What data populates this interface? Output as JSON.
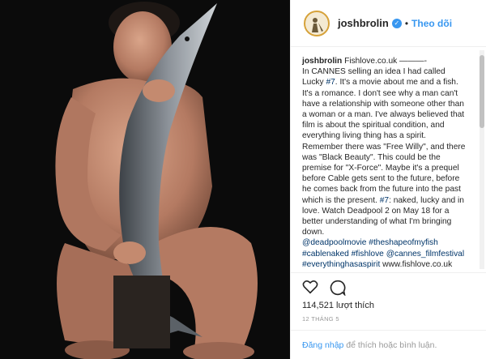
{
  "header": {
    "username": "joshbrolin",
    "separator": "•",
    "follow_label": "Theo dõi"
  },
  "caption": {
    "username": "joshbrolin",
    "line1": "Fishlove.co.uk ———-",
    "part_a": "In CANNES selling an idea I had called Lucky ",
    "hashtag7a": "#7",
    "part_b": ". It's a movie about me and a fish. It's a romance. I don't see why a man can't have a relationship with someone other than a woman or a man. I've always believed that film is about the spiritual condition, and everything living thing has a spirit. Remember there was \"Free Willy\", and there was \"Black Beauty\". This could be the premise for \"X-Force\". Maybe it's a prequel before Cable gets sent to the future, before he comes back from the future into the past which is the present.",
    "hashtag7b": "#7",
    "part_c": ": naked, lucky and in love. Watch Deadpool 2 on May 18 for a better understanding of what I'm bringing down.",
    "tag1": "@deadpoolmovie",
    "tag2": "#theshapeofmyfish",
    "tag3": "#cablenaked",
    "tag4": "#fishlove",
    "tag5": "@cannes_filmfestival",
    "tag6": "#everythinghasaspirit",
    "url": "www.fishlove.co.uk"
  },
  "actions": {
    "likes": "114,521 lượt thích",
    "date": "12 THÁNG 5"
  },
  "comment": {
    "login": "Đăng nhập",
    "rest": " để thích hoặc bình luận."
  },
  "colors": {
    "link": "#003569",
    "accent": "#3897f0",
    "muted": "#999999",
    "border": "#efefef"
  }
}
